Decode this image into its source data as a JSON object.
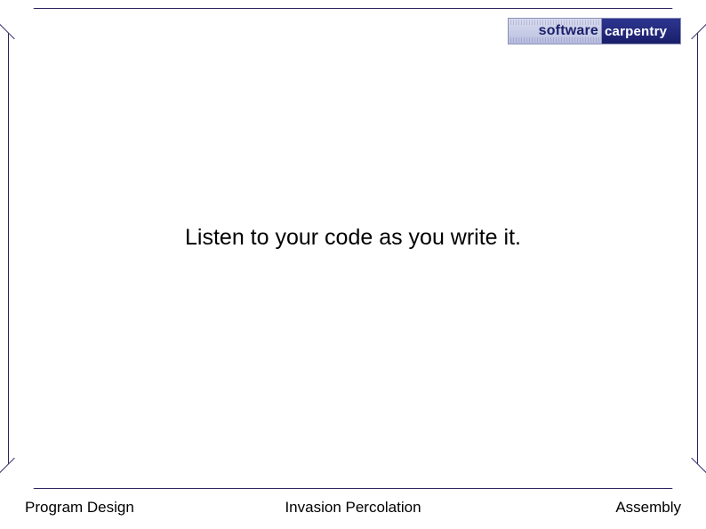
{
  "logo": {
    "left": "software",
    "right": "carpentry"
  },
  "main": {
    "text": "Listen to your code as you write it."
  },
  "footer": {
    "left": "Program Design",
    "center": "Invasion Percolation",
    "right": "Assembly"
  }
}
